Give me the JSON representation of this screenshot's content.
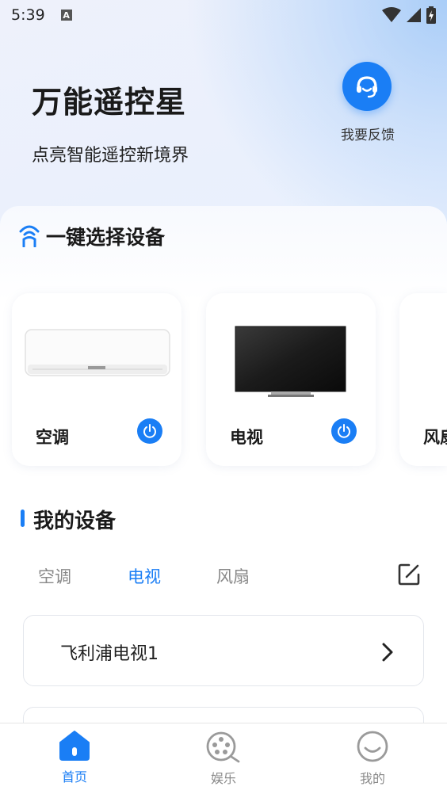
{
  "status_bar": {
    "time": "5:39",
    "badge": "A"
  },
  "header": {
    "title": "万能遥控星",
    "subtitle": "点亮智能遥控新境界",
    "feedback_label": "我要反馈"
  },
  "quick_select": {
    "title": "一键选择设备",
    "devices": [
      {
        "name": "空调",
        "icon": "air-conditioner-image"
      },
      {
        "name": "电视",
        "icon": "television-image"
      },
      {
        "name": "风扇",
        "icon": "fan-image"
      }
    ]
  },
  "my_devices": {
    "title": "我的设备",
    "tabs": [
      "空调",
      "电视",
      "风扇"
    ],
    "active_tab": "电视",
    "items": [
      "飞利浦电视1"
    ]
  },
  "bottom_nav": {
    "items": [
      {
        "label": "首页",
        "icon": "home-icon",
        "active": true
      },
      {
        "label": "娱乐",
        "icon": "film-reel-icon",
        "active": false
      },
      {
        "label": "我的",
        "icon": "smile-icon",
        "active": false
      }
    ]
  },
  "colors": {
    "accent": "#1a7ef5",
    "inactive": "#8a8a8a"
  }
}
